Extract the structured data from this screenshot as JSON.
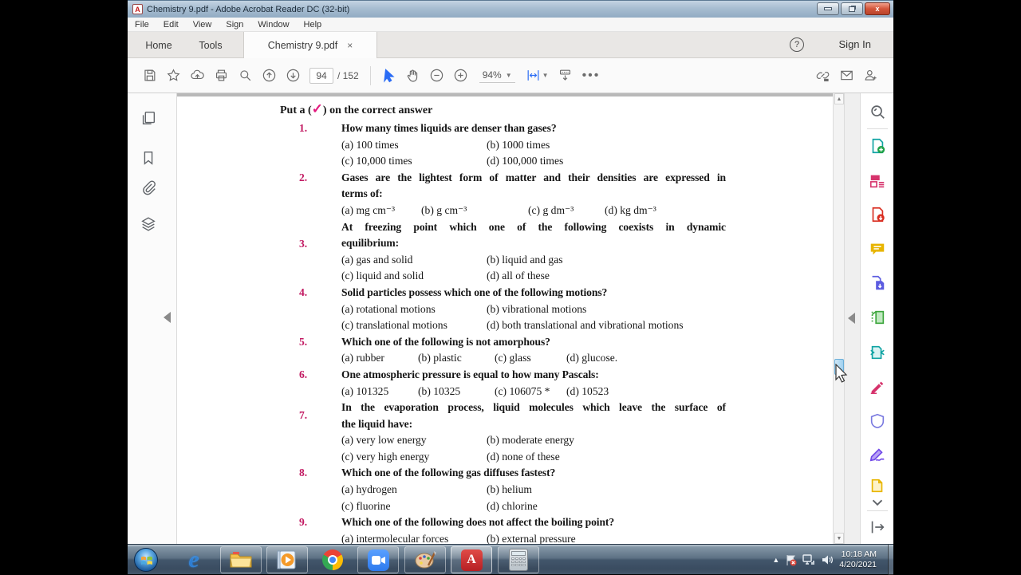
{
  "window": {
    "title": "Chemistry 9.pdf - Adobe Acrobat Reader DC (32-bit)",
    "pdf_badge": "A"
  },
  "menu": {
    "items": [
      "File",
      "Edit",
      "View",
      "Sign",
      "Window",
      "Help"
    ]
  },
  "tabs": {
    "home": "Home",
    "tools": "Tools",
    "doc": "Chemistry 9.pdf",
    "close_glyph": "×"
  },
  "header": {
    "help_glyph": "?",
    "sign_in": "Sign In"
  },
  "toolbar": {
    "page_current": "94",
    "page_total": "/ 152",
    "zoom_level": "94%",
    "more_dots": "•••"
  },
  "colors": {
    "accent_blue": "#2a6cf5",
    "question_number": "#c21a62",
    "check_magenta": "#e2187d",
    "acrobat_red": "#b61f23",
    "comment_yellow": "#e8b500",
    "export_red": "#d92d20",
    "create_teal": "#0fa3a3",
    "redact_pink": "#d6336c",
    "protect_purple": "#6f5ce8",
    "organize_green": "#3da63d"
  },
  "document": {
    "instruction_prefix": "Put a (",
    "check_glyph": "✓",
    "instruction_suffix": ") on the correct answer",
    "questions": [
      {
        "num": "1.",
        "lines": [
          "How many times liquids are denser than gases?"
        ],
        "layout": "cols2",
        "options": [
          {
            "label": "(a)",
            "text": "100 times"
          },
          {
            "label": "(b)",
            "text": "1000 times"
          },
          {
            "label": "(c)",
            "text": "10,000 times"
          },
          {
            "label": "(d)",
            "text": "100,000 times"
          }
        ]
      },
      {
        "num": "2.",
        "lines": [
          "Gases are the lightest form of matter and their densities are expressed in",
          "terms of:"
        ],
        "layout": "cols4a",
        "options": [
          {
            "label": "(a)",
            "text": "mg cm⁻³"
          },
          {
            "label": "(b)",
            "text": "g cm⁻³"
          },
          {
            "label": "(c)",
            "text": "g dm⁻³"
          },
          {
            "label": "(d)",
            "text": "kg dm⁻³"
          }
        ]
      },
      {
        "num": "3.",
        "lines": [
          "At freezing point  which one of the following coexists in dynamic",
          "equilibrium:"
        ],
        "layout": "cols2",
        "options": [
          {
            "label": "(a)",
            "text": "gas and solid"
          },
          {
            "label": "(b)",
            "text": "liquid and gas"
          },
          {
            "label": "(c)",
            "text": "liquid and solid"
          },
          {
            "label": "(d)",
            "text": "all of these"
          }
        ]
      },
      {
        "num": "4.",
        "lines": [
          "Solid particles possess which one of the following motions?"
        ],
        "layout": "cols2",
        "options": [
          {
            "label": "(a)",
            "text": "rotational motions"
          },
          {
            "label": "(b)",
            "text": "vibrational motions"
          },
          {
            "label": "(c)",
            "text": "translational motions"
          },
          {
            "label": "(d)",
            "text": "both translational and vibrational motions"
          }
        ]
      },
      {
        "num": "5.",
        "lines": [
          "Which one of the following is not amorphous?"
        ],
        "layout": "cols4b",
        "options": [
          {
            "label": "(a)",
            "text": "rubber"
          },
          {
            "label": "(b)",
            "text": "plastic"
          },
          {
            "label": "(c)",
            "text": "glass"
          },
          {
            "label": "(d)",
            "text": "glucose."
          }
        ]
      },
      {
        "num": "6.",
        "lines": [
          "One atmospheric pressure is equal to how many Pascals:"
        ],
        "layout": "cols4b",
        "options": [
          {
            "label": "(a)",
            "text": "101325"
          },
          {
            "label": "(b)",
            "text": "10325"
          },
          {
            "label": "(c)",
            "text": "106075 *"
          },
          {
            "label": "(d)",
            "text": "10523"
          }
        ]
      },
      {
        "num": "7.",
        "lines": [
          "In the evaporation process, liquid molecules which leave the surface of",
          "the liquid have:"
        ],
        "layout": "cols2",
        "options": [
          {
            "label": "(a)",
            "text": "very low energy"
          },
          {
            "label": "(b)",
            "text": "moderate energy"
          },
          {
            "label": "(c)",
            "text": "very high energy"
          },
          {
            "label": "(d)",
            "text": "none of these"
          }
        ]
      },
      {
        "num": "8.",
        "lines": [
          "Which one of the following gas diffuses fastest?"
        ],
        "layout": "cols2",
        "options": [
          {
            "label": "(a)",
            "text": "hydrogen"
          },
          {
            "label": "(b)",
            "text": "helium"
          },
          {
            "label": "(c)",
            "text": "fluorine"
          },
          {
            "label": "(d)",
            "text": "chlorine"
          }
        ]
      },
      {
        "num": "9.",
        "lines": [
          "Which one of the following does not affect the boiling point?"
        ],
        "layout": "cols2",
        "options": [
          {
            "label": "(a)",
            "text": "intermolecular forces"
          },
          {
            "label": "(b)",
            "text": "external pressure"
          }
        ]
      }
    ]
  },
  "taskbar": {
    "clock_time": "10:18 AM",
    "clock_date": "4/20/2021"
  }
}
